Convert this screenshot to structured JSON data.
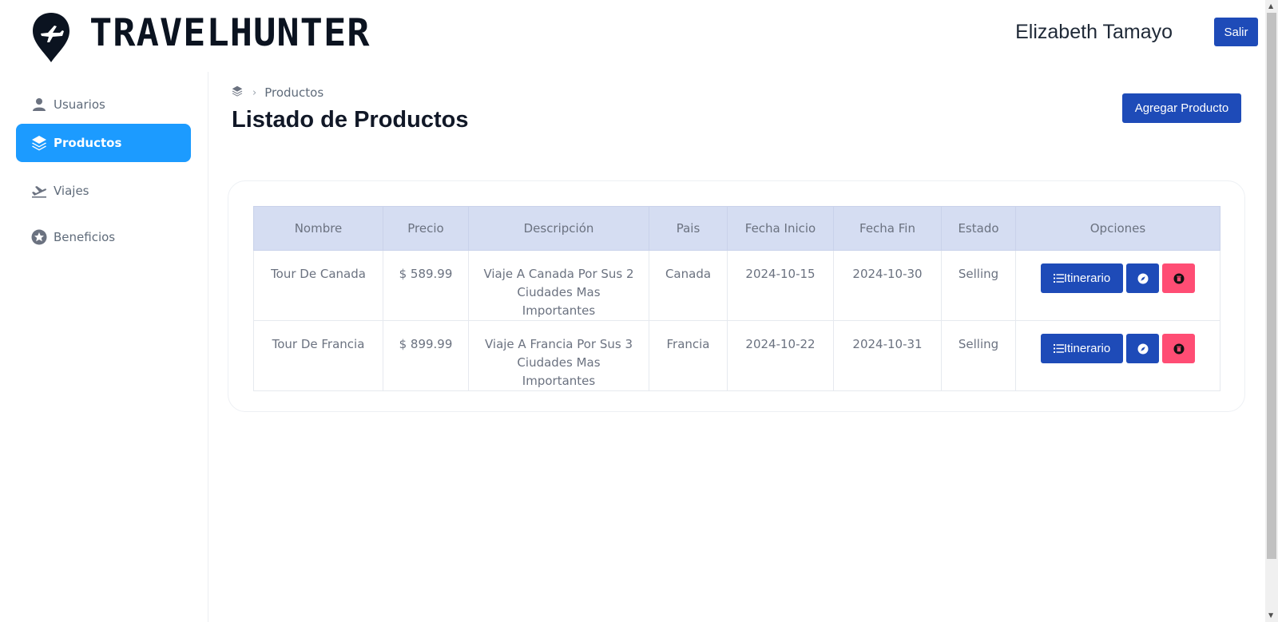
{
  "brand": {
    "name": "TRAVELHUNTER"
  },
  "header": {
    "user_name": "Elizabeth Tamayo",
    "logout_label": "Salir"
  },
  "sidebar": {
    "items": [
      {
        "label": "Usuarios",
        "icon": "user-icon",
        "active": false
      },
      {
        "label": "Productos",
        "icon": "layers-icon",
        "active": true
      },
      {
        "label": "Viajes",
        "icon": "plane-departure-icon",
        "active": false
      },
      {
        "label": "Beneficios",
        "icon": "star-circle-icon",
        "active": false
      }
    ]
  },
  "breadcrumb": {
    "home_icon": "layers-icon",
    "current": "Productos"
  },
  "page": {
    "title": "Listado de Productos",
    "add_button": "Agregar Producto"
  },
  "table": {
    "headers": [
      "Nombre",
      "Precio",
      "Descripción",
      "Pais",
      "Fecha Inicio",
      "Fecha Fin",
      "Estado",
      "Opciones"
    ],
    "rows": [
      {
        "nombre": "Tour De Canada",
        "precio": "$ 589.99",
        "descripcion": "Viaje A Canada Por Sus 2 Ciudades Mas Importantes",
        "pais": "Canada",
        "fecha_inicio": "2024-10-15",
        "fecha_fin": "2024-10-30",
        "estado": "Selling",
        "itinerario_label": "Itinerario"
      },
      {
        "nombre": "Tour De Francia",
        "precio": "$ 899.99",
        "descripcion": "Viaje A Francia Por Sus 3 Ciudades Mas Importantes",
        "pais": "Francia",
        "fecha_inicio": "2024-10-22",
        "fecha_fin": "2024-10-31",
        "estado": "Selling",
        "itinerario_label": "Itinerario"
      }
    ]
  },
  "colors": {
    "primary": "#1e4bb8",
    "sidebar_active": "#1c9bff",
    "danger": "#ff4d74",
    "table_header": "#d5ddf2"
  }
}
